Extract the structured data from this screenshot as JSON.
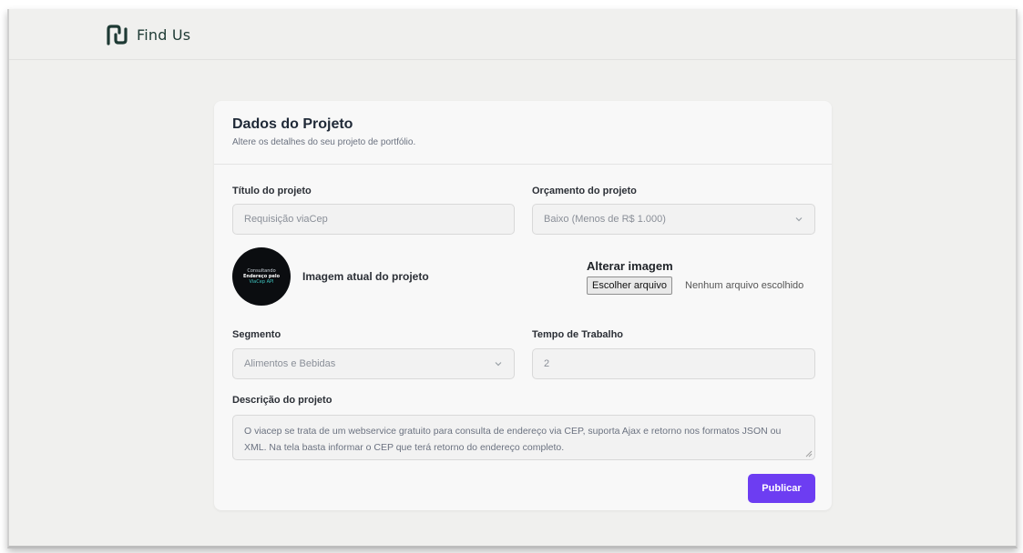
{
  "app": {
    "name": "Find Us"
  },
  "card": {
    "title": "Dados do Projeto",
    "subtitle": "Altere os detalhes do seu projeto de portfólio."
  },
  "form": {
    "title_label": "Título do projeto",
    "title_value": "Requisição viaCep",
    "budget_label": "Orçamento do projeto",
    "budget_value": "Baixo (Menos de R$ 1.000)",
    "image_label": "Imagem atual do projeto",
    "image_thumb_lines": [
      "Consultando",
      "Endereço pelo",
      "ViaCep API"
    ],
    "change_image_label": "Alterar imagem",
    "file_button_label": "Escolher arquivo",
    "file_status": "Nenhum arquivo escolhido",
    "segment_label": "Segmento",
    "segment_value": "Alimentos e Bebidas",
    "work_time_label": "Tempo de Trabalho",
    "work_time_value": "2",
    "description_label": "Descrição do projeto",
    "description_value": "O viacep se trata de um webservice gratuito para consulta de endereço via CEP, suporta Ajax e retorno nos formatos JSON ou XML. Na tela basta informar o CEP que terá retorno do endereço completo.",
    "publish_label": "Publicar"
  },
  "colors": {
    "accent": "#6d3df2",
    "brand": "#1e3a34",
    "background": "#f0f0ee"
  },
  "icons": {
    "logo": "find-us-logo-icon",
    "select_arrow": "chevron-down-icon"
  }
}
